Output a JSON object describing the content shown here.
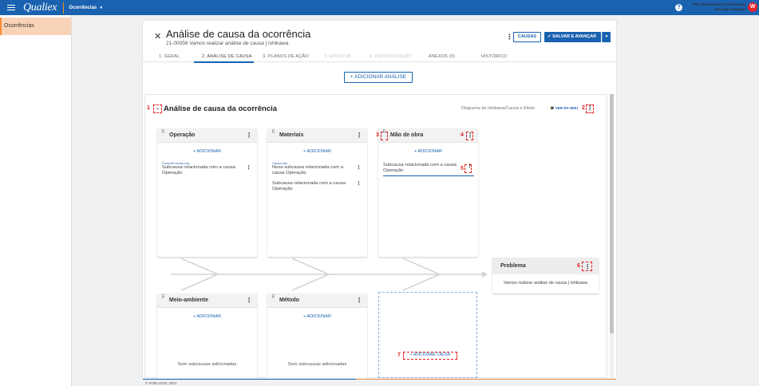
{
  "topbar": {
    "logo": "Qualiex",
    "module": "Ocorrências",
    "user_line1": "Wiki [Permissões Ocorrências]",
    "user_line2": "ForLogic Hangout",
    "avatar_letter": "W",
    "help_glyph": "?"
  },
  "sidebar": {
    "items": [
      {
        "label": "Ocorrências"
      }
    ]
  },
  "header": {
    "title": "Análise de causa da ocorrência",
    "subtitle": "21-00056 Vamos realizar análise de causa | Ishikawa",
    "causes_button": "CAUSAS",
    "save_button": "SALVAR E AVANÇAR"
  },
  "tabs": [
    {
      "label": "1. GERAL",
      "disabled": false
    },
    {
      "label": "2. ANÁLISE DE CAUSA",
      "disabled": false,
      "active": true
    },
    {
      "label": "3. PLANOS DE AÇÃO",
      "disabled": false
    },
    {
      "label": "4. EFICÁCIA",
      "disabled": true
    },
    {
      "label": "5. PADRONIZAÇÃO",
      "disabled": true
    },
    {
      "label": "ANEXOS (0)",
      "disabled": false
    },
    {
      "label": "HISTÓRICO",
      "disabled": false
    }
  ],
  "add_analysis_button": "+ ADICIONAR ANÁLISE",
  "analysis": {
    "title": "Análise de causa da ocorrência",
    "diagram_label": "Diagrama de Ishikawa/Causa e Efeito",
    "wiki_link": "VER NA WIKI"
  },
  "add_label": "+ ADICIONAR",
  "add_cause_button": "+ ADICIONAR CAUSA",
  "empty_text": "Sem subcausas adicionadas",
  "categories": [
    {
      "title": "Operação",
      "subcauses": [
        {
          "tag": "Possível causa raiz",
          "text": "Subcausa relacionada com a causa Operação"
        }
      ]
    },
    {
      "title": "Materiais",
      "subcauses": [
        {
          "tag": "Causa raiz",
          "text": "Nova subcausa relacionada com a causa Operação"
        },
        {
          "tag": "",
          "text": "Subcausa relacionada com a causa Operação"
        }
      ]
    },
    {
      "title": "Mão de obra",
      "subcauses": [
        {
          "tag": "",
          "text": "Subcausa relacionada com a causa Operação"
        }
      ]
    },
    {
      "title": "Meio-ambiente",
      "subcauses": []
    },
    {
      "title": "Método",
      "subcauses": []
    }
  ],
  "problem": {
    "title": "Problema",
    "description": "Vamos realizar análise de causa | Ishikawa"
  },
  "annotations": [
    "1",
    "2",
    "3",
    "4",
    "5",
    "6",
    "7"
  ],
  "footer": {
    "copyright": "© FORLOGIC 2021"
  },
  "colors": {
    "primary": "#1a62b0",
    "accent": "#f58a3c",
    "annotation": "#e02020",
    "avatar": "#e2242c"
  },
  "icons": {
    "menu": "hamburger-icon",
    "close": "close-icon",
    "kebab": "kebab-icon",
    "drag": "drag-handle-icon",
    "wiki": "graduation-cap-icon",
    "help": "help-icon"
  }
}
